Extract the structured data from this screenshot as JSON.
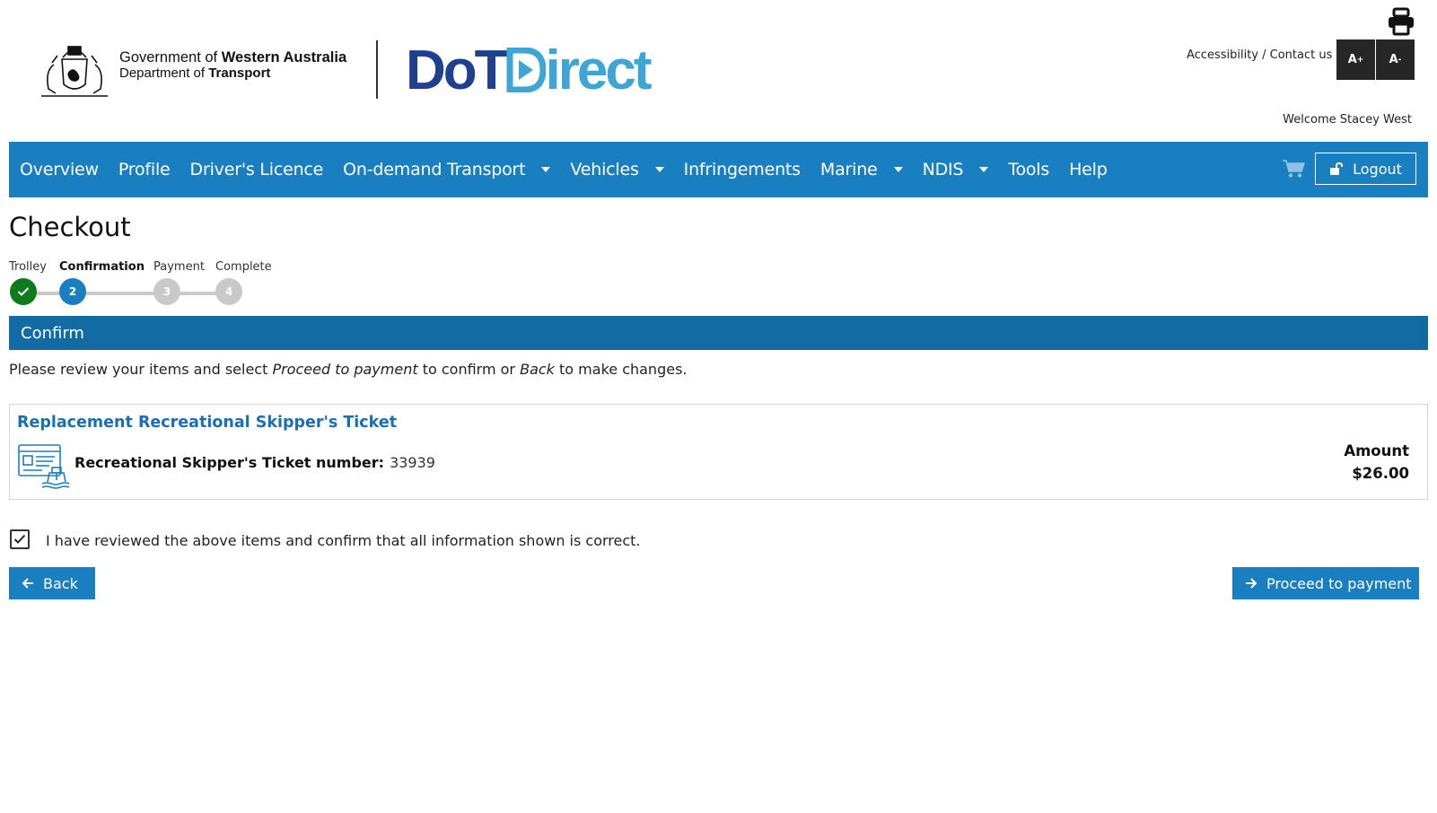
{
  "header": {
    "gov_line1_prefix": "Government of ",
    "gov_line1_bold": "Western Australia",
    "gov_line2_prefix": "Department of ",
    "gov_line2_bold": "Transport",
    "brand_dot": "DoT",
    "brand_direct": "irect",
    "accessibility_link": "Accessibility / Contact us",
    "font_increase": "A",
    "font_increase_sup": "+",
    "font_decrease": "A",
    "font_decrease_sup": "-",
    "welcome": "Welcome Stacey West"
  },
  "nav": {
    "items": [
      {
        "label": "Overview",
        "dropdown": false
      },
      {
        "label": "Profile",
        "dropdown": false
      },
      {
        "label": "Driver's Licence",
        "dropdown": false
      },
      {
        "label": "On-demand Transport",
        "dropdown": true
      },
      {
        "label": "Vehicles",
        "dropdown": true
      },
      {
        "label": "Infringements",
        "dropdown": false
      },
      {
        "label": "Marine",
        "dropdown": true
      },
      {
        "label": "NDIS",
        "dropdown": true
      },
      {
        "label": "Tools",
        "dropdown": false
      },
      {
        "label": "Help",
        "dropdown": false
      }
    ],
    "logout_label": "Logout"
  },
  "page": {
    "title": "Checkout"
  },
  "stepper": {
    "steps": [
      {
        "label": "Trolley",
        "status": "done",
        "number": "1"
      },
      {
        "label": "Confirmation",
        "status": "active",
        "number": "2"
      },
      {
        "label": "Payment",
        "status": "todo",
        "number": "3"
      },
      {
        "label": "Complete",
        "status": "todo",
        "number": "4"
      }
    ]
  },
  "confirm": {
    "section_title": "Confirm",
    "instr_part1": "Please review your items and select ",
    "instr_em1": "Proceed to payment",
    "instr_part2": " to confirm or ",
    "instr_em2": "Back",
    "instr_part3": " to make changes."
  },
  "item": {
    "title": "Replacement Recreational Skipper's Ticket",
    "detail_label": "Recreational Skipper's Ticket number:",
    "detail_value": "33939",
    "amount_label": "Amount",
    "amount_value": "$26.00"
  },
  "confirmation_checkbox": {
    "checked": true,
    "label": "I have reviewed the above items and confirm that all information shown is correct."
  },
  "actions": {
    "back_label": "Back",
    "proceed_label": "Proceed to payment"
  },
  "colors": {
    "nav_blue": "#1a7fc1",
    "section_blue": "#136ba3",
    "link_blue": "#1a6fb3",
    "done_green": "#0e7c1d",
    "brand_dark": "#1f3f8f",
    "brand_light": "#3ea6d4"
  }
}
